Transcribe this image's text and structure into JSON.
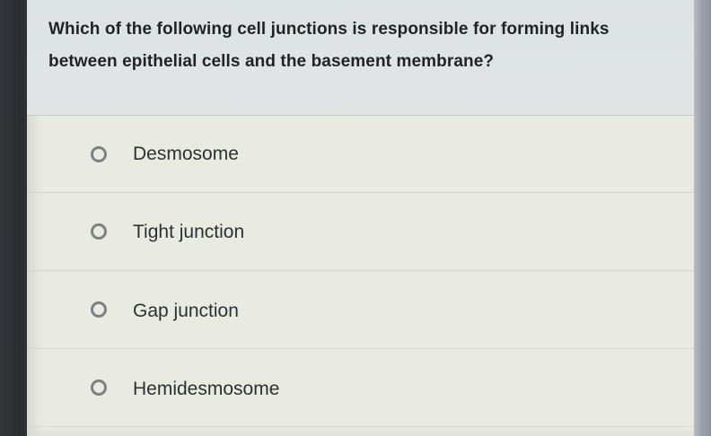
{
  "question": {
    "text": "Which of the following cell junctions is responsible for forming links between epithelial cells and the basement membrane?"
  },
  "options": [
    {
      "label": "Desmosome",
      "selected": false
    },
    {
      "label": "Tight junction",
      "selected": false
    },
    {
      "label": "Gap junction",
      "selected": false
    },
    {
      "label": "Hemidesmosome",
      "selected": false
    }
  ],
  "colors": {
    "card_background": "#e9ebe2",
    "question_background": "#dde2e3",
    "text": "#1f2326",
    "radio_border": "#7e8181"
  }
}
